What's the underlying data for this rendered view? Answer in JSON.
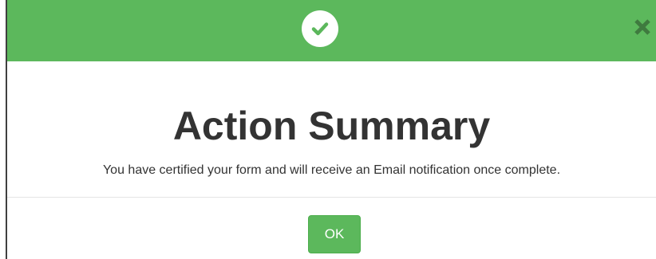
{
  "dialog": {
    "header": {
      "icon": "check-circle-icon",
      "close_icon": "close-icon",
      "background_color": "#5cb85c"
    },
    "title": "Action Summary",
    "message": "You have certified your form and will receive an Email notification once complete.",
    "ok_label": "OK"
  }
}
